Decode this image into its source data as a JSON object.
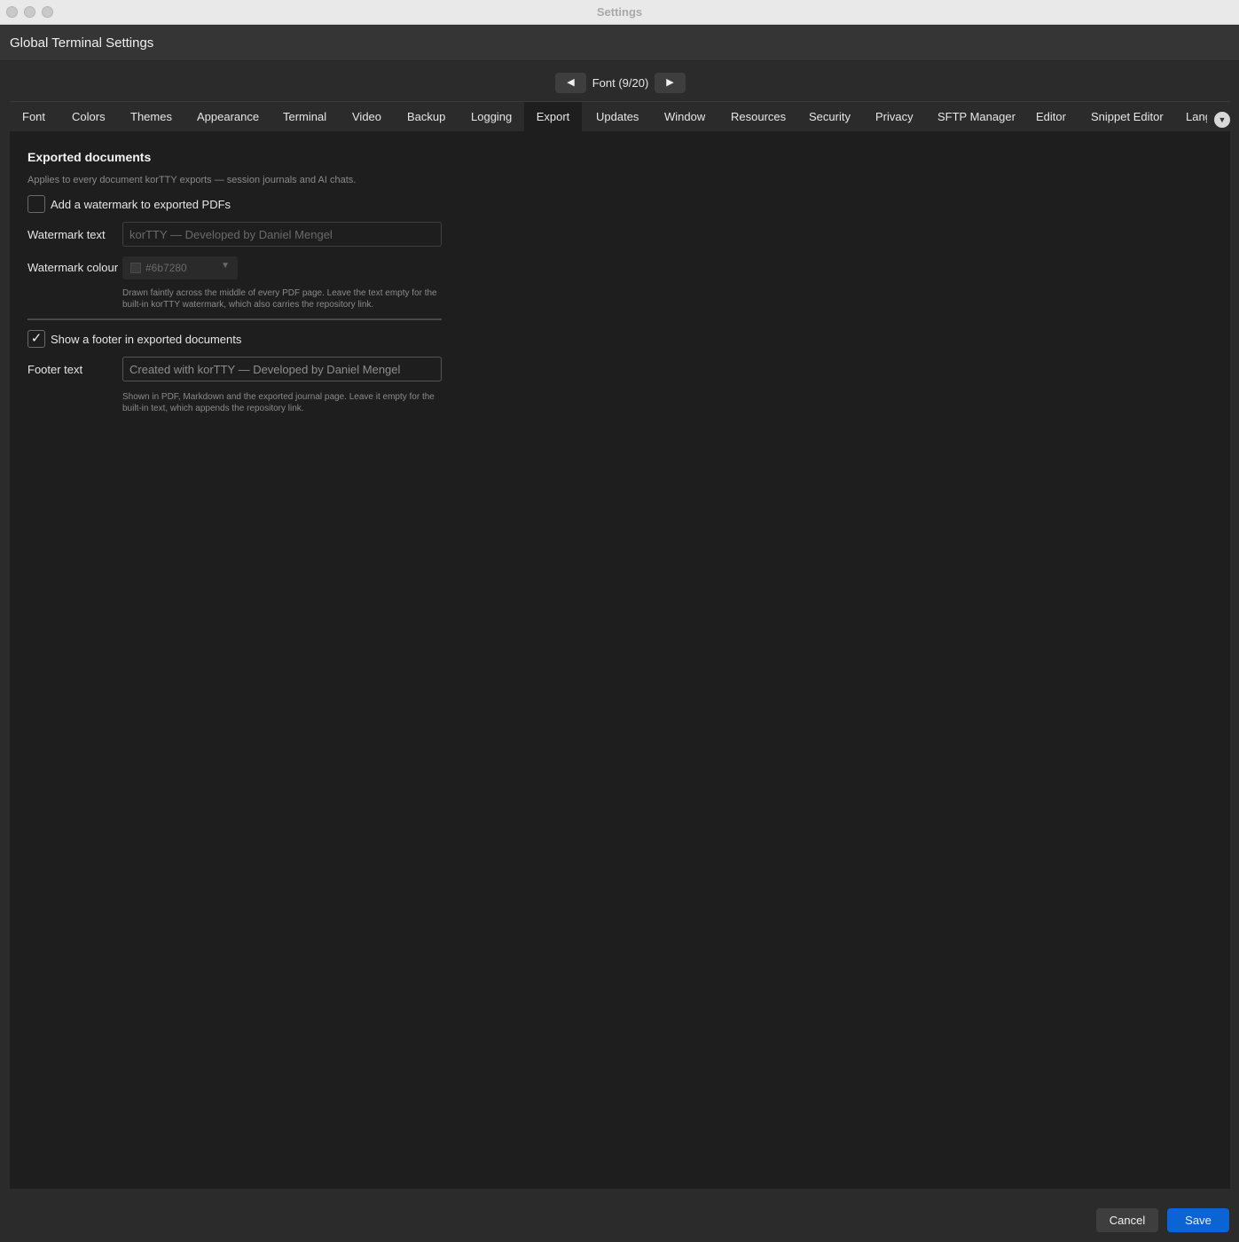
{
  "window": {
    "title": "Settings"
  },
  "header": {
    "title": "Global Terminal Settings"
  },
  "pager": {
    "prev_label": "◀",
    "next_label": "▶",
    "label": "Font (9/20)"
  },
  "tabs": [
    {
      "label": "Font"
    },
    {
      "label": "Colors"
    },
    {
      "label": "Themes"
    },
    {
      "label": "Appearance"
    },
    {
      "label": "Terminal"
    },
    {
      "label": "Video"
    },
    {
      "label": "Backup"
    },
    {
      "label": "Logging"
    },
    {
      "label": "Export",
      "active": true
    },
    {
      "label": "Updates"
    },
    {
      "label": "Window"
    },
    {
      "label": "Resources"
    },
    {
      "label": "Security"
    },
    {
      "label": "Privacy"
    },
    {
      "label": "SFTP Manager"
    },
    {
      "label": "Editor"
    },
    {
      "label": "Snippet Editor"
    },
    {
      "label": "Lang"
    }
  ],
  "tabs_overflow_icon": "chevron-down-icon",
  "export": {
    "title": "Exported documents",
    "description": "Applies to every document korTTY exports — session journals and AI chats.",
    "watermark_checkbox": {
      "label": "Add a watermark to exported PDFs",
      "checked": false
    },
    "watermark_text": {
      "label": "Watermark text",
      "placeholder": "korTTY — Developed by Daniel Mengel"
    },
    "watermark_colour": {
      "label": "Watermark colour",
      "value": "#6b7280"
    },
    "watermark_hint": "Drawn faintly across the middle of every PDF page. Leave the text empty for the built-in korTTY watermark, which also carries the repository link.",
    "footer_checkbox": {
      "label": "Show a footer in exported documents",
      "checked": true,
      "mark": "✓"
    },
    "footer_text": {
      "label": "Footer text",
      "placeholder": "Created with korTTY — Developed by Daniel Mengel"
    },
    "footer_hint": "Shown in PDF, Markdown and the exported journal page. Leave it empty for the built-in text, which appends the repository link."
  },
  "actions": {
    "cancel_label": "Cancel",
    "save_label": "Save"
  },
  "colors": {
    "accent": "#0a64d6",
    "background": "#1e1e1e",
    "chrome": "#2b2b2b"
  }
}
